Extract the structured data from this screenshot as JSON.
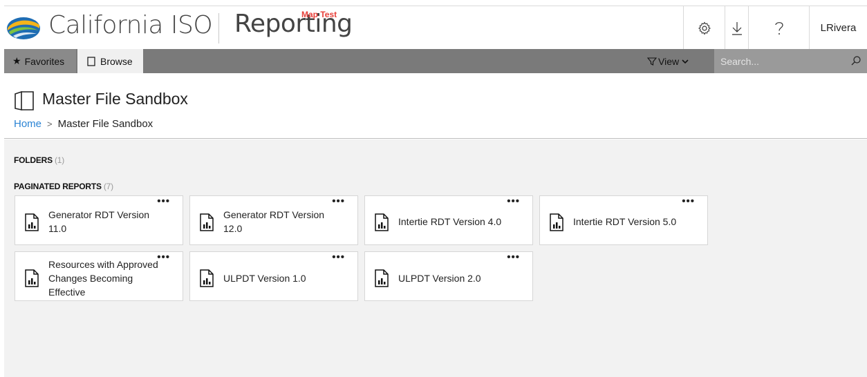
{
  "header": {
    "brand": "California ISO",
    "product": "Reporting",
    "environment_tag": "Map Test",
    "user": "LRivera",
    "settings_icon": "gear-icon",
    "download_icon": "download-icon",
    "help_icon": "question-icon"
  },
  "nav": {
    "favorites_label": "Favorites",
    "browse_label": "Browse",
    "view_label": "View",
    "search_placeholder": "Search..."
  },
  "page": {
    "title": "Master File Sandbox",
    "breadcrumb_home": "Home",
    "breadcrumb_separator": ">",
    "breadcrumb_current": "Master File Sandbox"
  },
  "sections": {
    "folders_label": "FOLDERS",
    "folders_count": "(1)",
    "reports_label": "PAGINATED REPORTS",
    "reports_count": "(7)"
  },
  "reports": [
    {
      "title": "Generator RDT Version 11.0",
      "menu": "•••"
    },
    {
      "title": "Generator RDT Version 12.0",
      "menu": "•••"
    },
    {
      "title": "Intertie RDT Version 4.0",
      "menu": "•••"
    },
    {
      "title": "Intertie RDT Version 5.0",
      "menu": "•••"
    },
    {
      "title": "Resources with Approved Changes Becoming Effective",
      "menu": "•••"
    },
    {
      "title": "ULPDT Version 1.0",
      "menu": "•••"
    },
    {
      "title": "ULPDT Version 2.0",
      "menu": "•••"
    }
  ],
  "colors": {
    "accent_link": "#2a83d4",
    "env_tag": "#e8403a",
    "nav_bg": "#7a7a7a",
    "content_bg": "#f2f2f2"
  }
}
